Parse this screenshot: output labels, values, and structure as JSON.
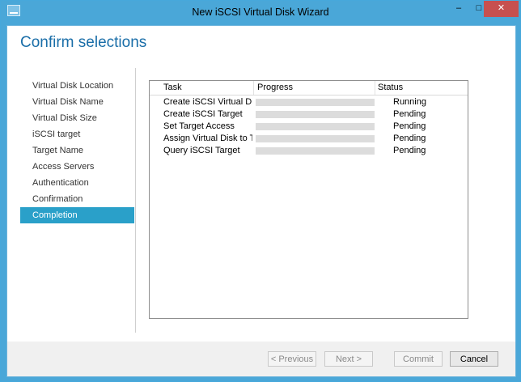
{
  "window": {
    "title": "New iSCSI Virtual Disk Wizard"
  },
  "titlebar_buttons": {
    "minimize": "–",
    "maximize": "□",
    "close": "✕"
  },
  "page": {
    "title": "Confirm selections"
  },
  "nav": {
    "items": [
      {
        "label": "Virtual Disk Location",
        "active": false
      },
      {
        "label": "Virtual Disk Name",
        "active": false
      },
      {
        "label": "Virtual Disk Size",
        "active": false
      },
      {
        "label": "iSCSI target",
        "active": false
      },
      {
        "label": "Target Name",
        "active": false
      },
      {
        "label": "Access Servers",
        "active": false
      },
      {
        "label": "Authentication",
        "active": false
      },
      {
        "label": "Confirmation",
        "active": false
      },
      {
        "label": "Completion",
        "active": true
      }
    ]
  },
  "tasks": {
    "headers": {
      "task": "Task",
      "progress": "Progress",
      "status": "Status"
    },
    "rows": [
      {
        "task": "Create iSCSI Virtual Disk",
        "progress": 0,
        "status": "Running"
      },
      {
        "task": "Create iSCSI Target",
        "progress": 0,
        "status": "Pending"
      },
      {
        "task": "Set Target Access",
        "progress": 0,
        "status": "Pending"
      },
      {
        "task": "Assign Virtual Disk to Target",
        "progress": 0,
        "status": "Pending"
      },
      {
        "task": "Query iSCSI Target",
        "progress": 0,
        "status": "Pending"
      }
    ]
  },
  "footer": {
    "previous": "< Previous",
    "next": "Next >",
    "commit": "Commit",
    "cancel": "Cancel"
  }
}
